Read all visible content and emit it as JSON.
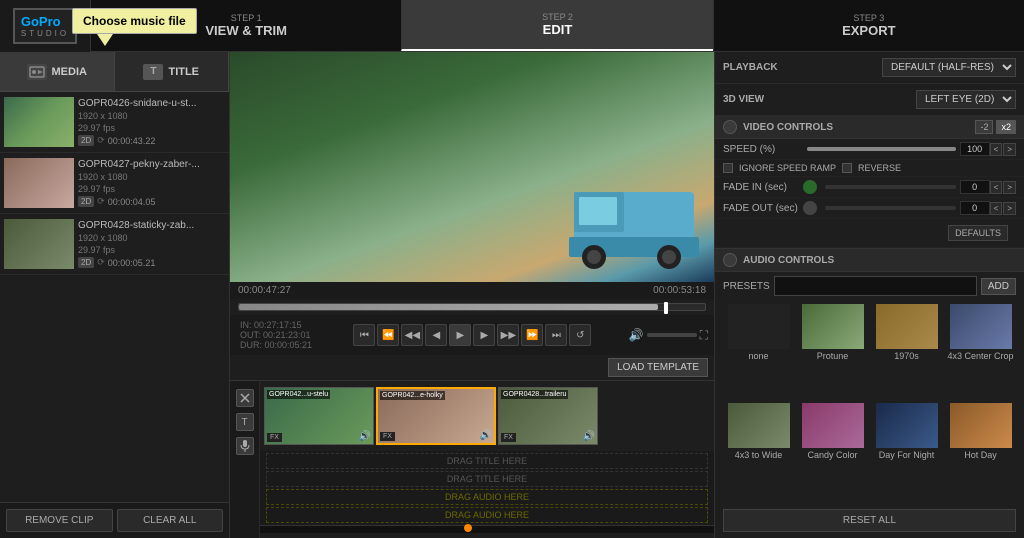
{
  "app": {
    "name": "GoPro",
    "studio": "STUDIO",
    "tooltip": "Choose music file"
  },
  "steps": [
    {
      "num": "STEP 1",
      "label": "VIEW & TRIM",
      "active": false
    },
    {
      "num": "STEP 2",
      "label": "EDIT",
      "active": true
    },
    {
      "num": "STEP 3",
      "label": "EXPORT",
      "active": false
    }
  ],
  "media_tabs": [
    {
      "label": "MEDIA",
      "active": true
    },
    {
      "label": "TITLE",
      "active": false
    }
  ],
  "clips": [
    {
      "name": "GOPR0426-snidane-u-st...",
      "res": "1920 x 1080",
      "fps": "29.97 fps",
      "duration": "00:00:43.22",
      "badge": "2D"
    },
    {
      "name": "GOPR0427-pekny-zaber-...",
      "res": "1920 x 1080",
      "fps": "29.97 fps",
      "duration": "00:00:04.05",
      "badge": "2D"
    },
    {
      "name": "GOPR0428-staticky-zab...",
      "res": "1920 x 1080",
      "fps": "29.97 fps",
      "duration": "00:00:05.21",
      "badge": "2D"
    }
  ],
  "bottom_buttons": [
    {
      "label": "REMOVE CLIP"
    },
    {
      "label": "CLEAR ALL"
    }
  ],
  "timecodes": {
    "current": "00:00:47:27",
    "total": "00:00:53:18"
  },
  "in_out": {
    "in": "IN: 00:27:17:15",
    "out": "OUT: 00:21:23:01",
    "dur": "DUR: 00:00:05:21"
  },
  "timeline_clips": [
    {
      "label": "GOPR042...u-stelu",
      "fx": true,
      "audio": true
    },
    {
      "label": "GOPR042...e-holky",
      "fx": true,
      "audio": true,
      "selected": true
    },
    {
      "label": "GOPR0428...traileru",
      "fx": true,
      "audio": true
    }
  ],
  "drag_labels": [
    {
      "label": "DRAG TITLE HERE",
      "type": "title"
    },
    {
      "label": "DRAG TITLE HERE",
      "type": "title"
    },
    {
      "label": "DRAG AUDIO HERE",
      "type": "audio"
    },
    {
      "label": "DRAG AUDIO HERE",
      "type": "audio"
    }
  ],
  "right_panel": {
    "playback_label": "PLAYBACK",
    "playback_value": "DEFAULT (HALF-RES)",
    "view_3d_label": "3D VIEW",
    "view_3d_value": "LEFT EYE (2D)",
    "video_controls_label": "VIDEO CONTROLS",
    "speed_label": "SPEED (%)",
    "speed_value": "100",
    "ignore_speed_ramp": "IGNORE SPEED RAMP",
    "reverse": "REVERSE",
    "fade_in_label": "FADE IN (sec)",
    "fade_in_value": "0",
    "fade_out_label": "FADE OUT (sec)",
    "fade_out_value": "0",
    "defaults_btn": "DEFAULTS",
    "audio_controls_label": "AUDIO CONTROLS",
    "presets_label": "PRESETS",
    "add_btn": "ADD",
    "presets": [
      {
        "label": "none",
        "class": "pt-none"
      },
      {
        "label": "Protune",
        "class": "pt-protune"
      },
      {
        "label": "1970s",
        "class": "pt-1970s"
      },
      {
        "label": "4x3 Center Crop",
        "class": "pt-4x3center"
      },
      {
        "label": "4x3 to Wide",
        "class": "pt-4x3wide"
      },
      {
        "label": "Candy Color",
        "class": "pt-candy"
      },
      {
        "label": "Day For Night",
        "class": "pt-dayfornight"
      },
      {
        "label": "Hot Day",
        "class": "pt-hotday"
      }
    ],
    "reset_all": "RESET ALL"
  },
  "load_template": "LOAD TEMPLATE"
}
